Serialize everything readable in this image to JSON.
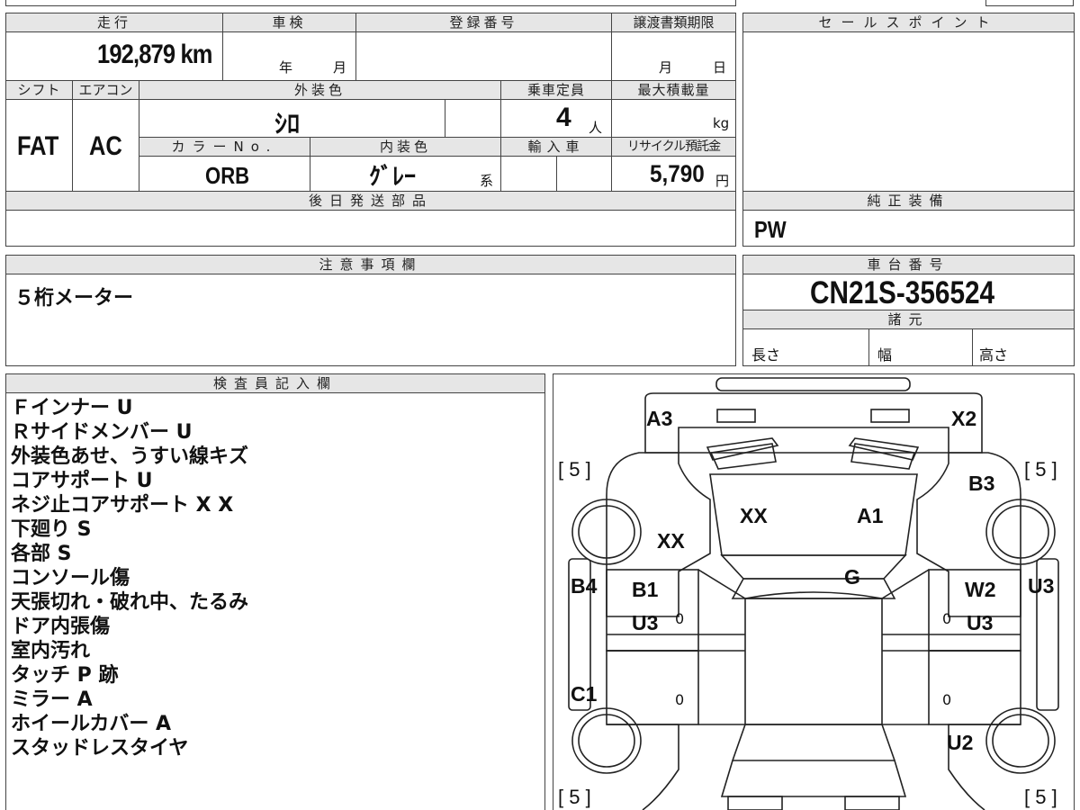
{
  "headers": {
    "mileage": "走行",
    "inspection": "車検",
    "registration_no": "登録番号",
    "transfer_deadline": "譲渡書類期限",
    "sales_point": "セールスポイント",
    "shift": "シフト",
    "aircon": "エアコン",
    "exterior_color": "外装色",
    "capacity": "乗車定員",
    "max_load": "最大積載量",
    "color_no": "カラーNo.",
    "interior_color": "内装色",
    "imported": "輸入車",
    "recycle_fee": "リサイクル預託金",
    "later_parts": "後日発送部品",
    "genuine_equipment": "純正装備",
    "caution": "注意事項欄",
    "chassis_no": "車台番号",
    "specs": "諸元",
    "inspector_notes": "検査員記入欄"
  },
  "values": {
    "mileage": "192,879 km",
    "inspection_year_unit": "年",
    "inspection_month_unit": "月",
    "transfer_month_unit": "月",
    "transfer_day_unit": "日",
    "shift": "FAT",
    "aircon": "AC",
    "exterior_color": "ｼﾛ",
    "capacity": "4",
    "capacity_unit": "人",
    "max_load_unit": "kg",
    "color_no": "ORB",
    "interior_color": "ｸﾞﾚｰ",
    "interior_suffix": "系",
    "recycle_fee": "5,790",
    "recycle_unit": "円",
    "genuine_equipment": "PW",
    "caution": "５桁メーター",
    "chassis_no": "CN21S-356524",
    "length": "長さ",
    "width": "幅",
    "height": "高さ"
  },
  "inspector_notes": [
    "Ｆインナー U",
    "Ｒサイドメンバー U",
    "外装色あせ、うすい線キズ",
    "コアサポート U",
    "ネジ止コアサポート X X",
    "下廻り S",
    "各部 S",
    "コンソール傷",
    "天張切れ・破れ中、たるみ",
    "ドア内張傷",
    "室内汚れ",
    "タッチ P 跡",
    "ミラー A",
    "ホイールカバー A",
    "スタッドレスタイヤ"
  ],
  "diagram": {
    "tire_fl": "[ 5 ]",
    "tire_fr": "[ 5 ]",
    "tire_rl": "[ 5 ]",
    "tire_rr": "[ 5 ]",
    "a3": "A3",
    "x2": "X2",
    "b3": "B3",
    "xx_hood": "XX",
    "a1": "A1",
    "xx_left": "XX",
    "g": "G",
    "b4": "B4",
    "b1": "B1",
    "u3_left": "U3",
    "w2": "W2",
    "u3_right": "U3",
    "u3_right_door": "U3",
    "c1": "C1",
    "u2": "U2",
    "zero": "0"
  }
}
